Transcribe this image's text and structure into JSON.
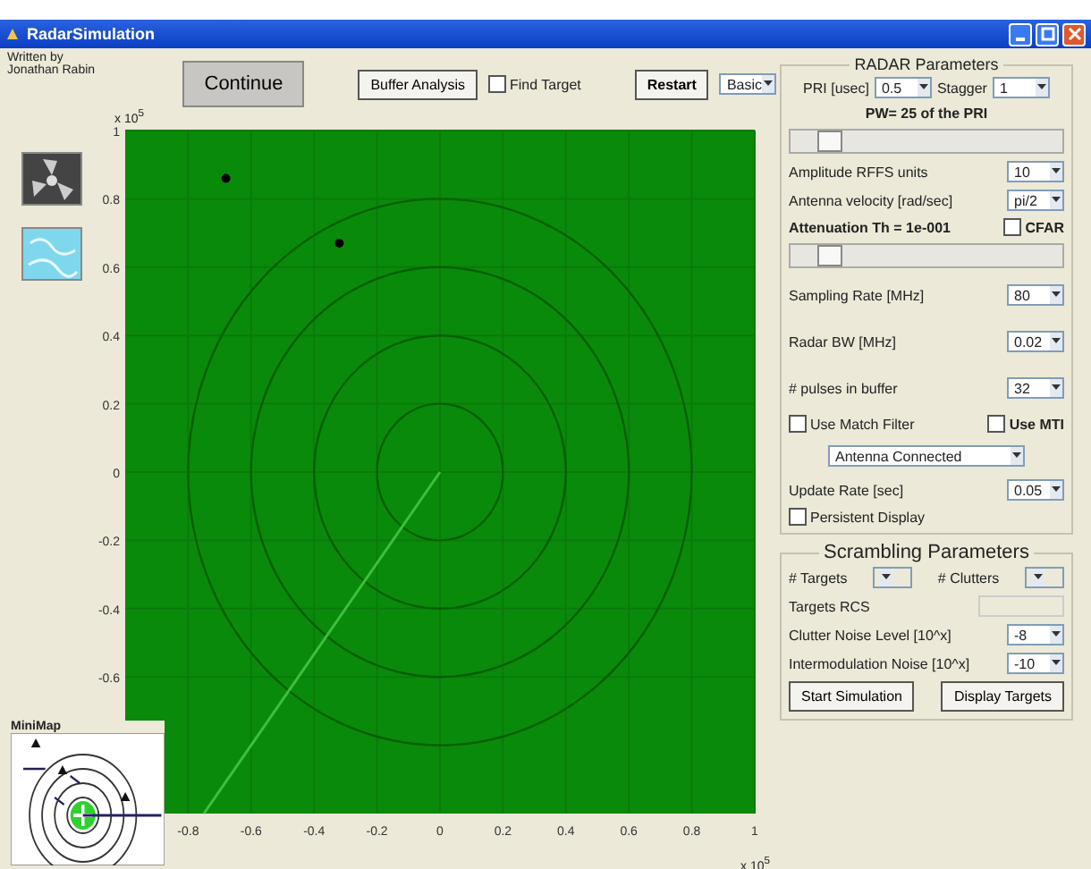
{
  "window": {
    "title": "RadarSimulation"
  },
  "credit": [
    "Written by",
    "Jonathan Rabin"
  ],
  "toolbar": {
    "continue": "Continue",
    "buffer_analysis": "Buffer Analysis",
    "find_target": {
      "label": "Find Target",
      "checked": false
    },
    "restart": "Restart",
    "mode": "Basic"
  },
  "plot": {
    "y_exponent": "x 10$^{5}$",
    "x_exponent": "x 10$^{5}$",
    "chart_data": {
      "type": "scatter",
      "grid": true,
      "xlim": [
        -1,
        1
      ],
      "ylim": [
        -1,
        1
      ],
      "xticks": [
        -0.8,
        -0.6,
        -0.4,
        -0.2,
        0,
        0.2,
        0.4,
        0.6,
        0.8,
        1
      ],
      "yticks": [
        -0.6,
        -0.4,
        -0.2,
        0,
        0.2,
        0.4,
        0.6,
        0.8,
        1
      ],
      "x": [
        -0.68,
        -0.32
      ],
      "series": [
        {
          "color": "#000000",
          "values": [
            0.86,
            0.67
          ]
        }
      ]
    }
  },
  "minimap": {
    "title": "MiniMap"
  },
  "radar": {
    "title": "RADAR Parameters",
    "pri": {
      "label": "PRI [usec]",
      "value": "0.5"
    },
    "stagger": {
      "label": "Stagger",
      "value": "1"
    },
    "pw": {
      "label": "PW= 25 of the PRI",
      "level": 0.1
    },
    "fields": [
      {
        "label": "Amplitude RFFS units",
        "value": "10"
      },
      {
        "label": "Antenna velocity [rad/sec]",
        "value": "pi/2"
      }
    ],
    "attenuation": {
      "label": "Attenuation Th = 1e-001",
      "level": 0.1,
      "cfar": {
        "label": "CFAR",
        "checked": false
      }
    },
    "fields2": [
      {
        "label": "Sampling Rate [MHz]",
        "value": "80"
      },
      {
        "label": "Radar BW [MHz]",
        "value": "0.02"
      },
      {
        "label": "# pulses in buffer",
        "value": "32"
      }
    ],
    "match_filter": {
      "label": "Use Match Filter",
      "checked": false
    },
    "mti": {
      "label": "Use MTI",
      "checked": false
    },
    "antenna": "Antenna Connected",
    "update_rate": {
      "label": "Update Rate [sec]",
      "value": "0.05"
    },
    "persistent": {
      "label": "Persistent Display",
      "checked": false
    }
  },
  "scrambling": {
    "title": "Scrambling Parameters",
    "targets": "# Targets",
    "clutters": "# Clutters",
    "rcs": {
      "label": "Targets RCS",
      "disabled": true
    },
    "fields": [
      {
        "label": "Clutter Noise Level [10^x]",
        "value": "-8"
      },
      {
        "label": "Intermodulation Noise [10^x]",
        "value": "-10"
      }
    ],
    "buttons": [
      "Start Simulation",
      "Display Targets"
    ]
  }
}
